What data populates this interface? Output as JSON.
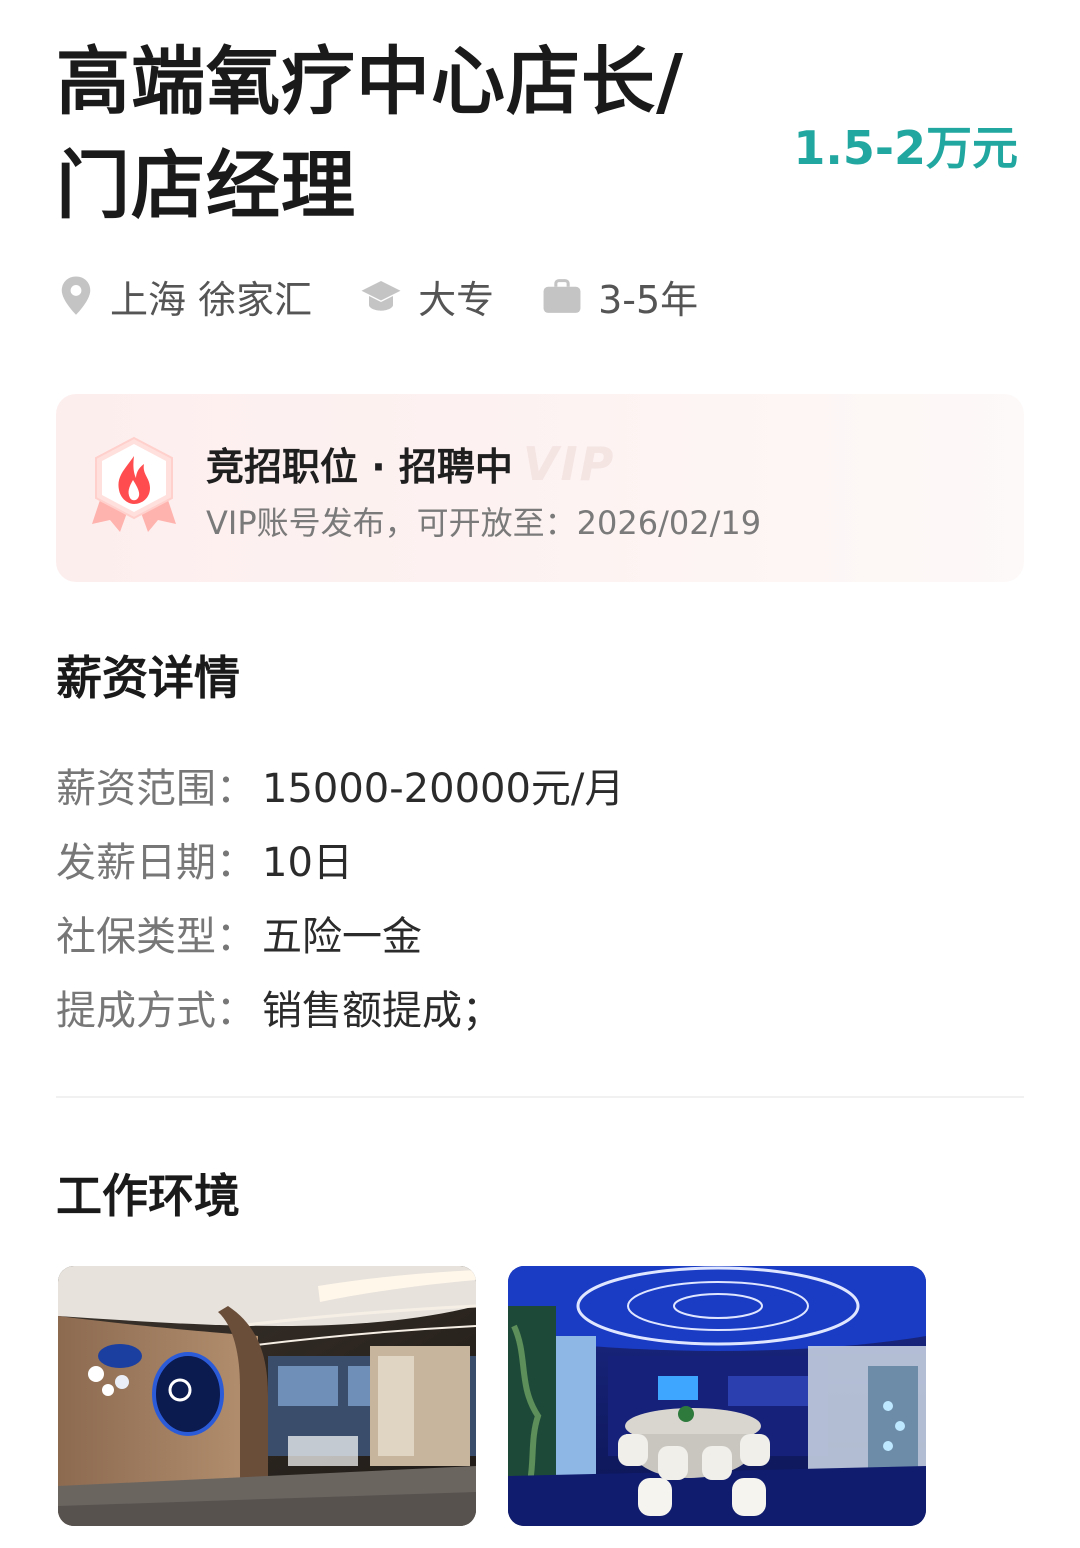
{
  "job": {
    "title": "高端氧疗中心店长/门店经理",
    "salary": "1.5-2万元",
    "location": "上海 徐家汇",
    "education": "大专",
    "experience": "3-5年"
  },
  "icons": {
    "location": "location-pin-icon",
    "education": "graduation-cap-icon",
    "experience": "briefcase-icon",
    "badge": "flame-badge-icon"
  },
  "promo_card": {
    "title": "竞招职位 · 招聘中",
    "vip_mark": "VIP",
    "subtitle": "VIP账号发布，可开放至：2026/02/19"
  },
  "salary_section": {
    "title": "薪资详情",
    "rows": [
      {
        "key": "薪资范围：",
        "value": "15000-20000元/月"
      },
      {
        "key": "发薪日期：",
        "value": "10日"
      },
      {
        "key": "社保类型：",
        "value": "五险一金"
      },
      {
        "key": "提成方式：",
        "value": "销售额提成；"
      }
    ]
  },
  "environment_section": {
    "title": "工作环境",
    "photos": [
      "office-lobby-photo",
      "meeting-lounge-photo"
    ]
  },
  "colors": {
    "salary_accent": "#22a7a0",
    "badge_flame": "#ff4d4f",
    "card_background": "#fdeeee"
  }
}
